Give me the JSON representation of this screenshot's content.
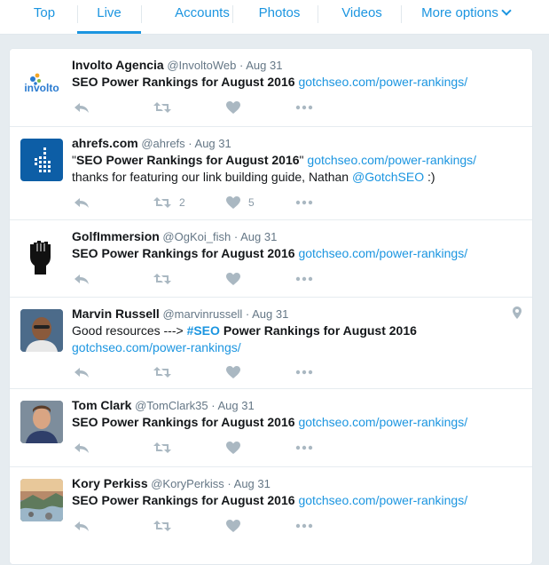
{
  "nav": {
    "tabs": [
      {
        "label": "Top",
        "active": false
      },
      {
        "label": "Live",
        "active": true
      },
      {
        "label": "Accounts",
        "active": false
      },
      {
        "label": "Photos",
        "active": false
      },
      {
        "label": "Videos",
        "active": false
      },
      {
        "label": "More options",
        "active": false
      }
    ]
  },
  "colors": {
    "link": "#1b95e0",
    "muted": "#657786",
    "icon": "#aab8c2",
    "background": "#e6ecf0"
  },
  "tweets": [
    {
      "fullname": "Involto Agencia",
      "username": "@InvoltoWeb",
      "dot": "·",
      "time": "Aug 31",
      "avatar_icon": "involto-logo",
      "avatar_label": "involto",
      "text_bold": "SEO Power Rankings for August 2016",
      "text_link": "gotchseo.com/power-rankings/"
    },
    {
      "fullname": "ahrefs.com",
      "username": "@ahrefs",
      "dot": "·",
      "time": "Aug 31",
      "avatar_icon": "ahrefs-logo",
      "quote_open": "\"",
      "text_bold": "SEO Power Rankings for August 2016",
      "quote_close": "\"",
      "text_link": "gotchseo.com/power-rankings/",
      "line2": "thanks for featuring our link building guide, Nathan",
      "mention": "@GotchSEO",
      "line2_end": ":)",
      "retweets": "2",
      "likes": "5"
    },
    {
      "fullname": "GolfImmersion",
      "username": "@OgKoi_fish",
      "dot": "·",
      "time": "Aug 31",
      "avatar_icon": "raised-fist-icon",
      "text_bold": "SEO Power Rankings for August 2016",
      "text_link": "gotchseo.com/power-rankings/"
    },
    {
      "fullname": "Marvin Russell",
      "username": "@marvinrussell",
      "dot": "·",
      "time": "Aug 31",
      "avatar_icon": "person-photo",
      "text_pre": "Good resources --->",
      "hashtag": "#SEO",
      "text_bold": "Power Rankings for August 2016",
      "text_link": "gotchseo.com/power-rankings/",
      "location_icon": "location-pin-icon"
    },
    {
      "fullname": "Tom Clark",
      "username": "@TomClark35",
      "dot": "·",
      "time": "Aug 31",
      "avatar_icon": "person-photo",
      "text_bold": "SEO Power Rankings for August 2016",
      "text_link": "gotchseo.com/power-rankings/"
    },
    {
      "fullname": "Kory Perkiss",
      "username": "@KoryPerkiss",
      "dot": "·",
      "time": "Aug 31",
      "avatar_icon": "landscape-photo",
      "text_bold": "SEO Power Rankings for August 2016",
      "text_link": "gotchseo.com/power-rankings/"
    }
  ]
}
